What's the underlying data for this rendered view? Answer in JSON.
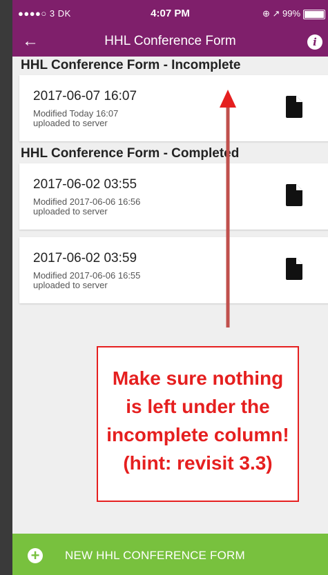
{
  "status": {
    "carrier": "●●●●○ 3 DK",
    "time": "4:07 PM",
    "right": "⊕ ↗ 99%"
  },
  "appbar": {
    "title": "HHL Conference Form"
  },
  "sections": {
    "incomplete": {
      "header": "HHL Conference Form - Incomplete",
      "items": [
        {
          "date": "2017-06-07 16:07",
          "modified": "Modified Today 16:07",
          "status": "uploaded to server"
        }
      ]
    },
    "completed": {
      "header": "HHL Conference Form - Completed",
      "items": [
        {
          "date": "2017-06-02 03:55",
          "modified": "Modified 2017-06-06 16:56",
          "status": "uploaded to server"
        },
        {
          "date": "2017-06-02 03:59",
          "modified": "Modified 2017-06-06 16:55",
          "status": "uploaded to server"
        }
      ]
    }
  },
  "annotation": {
    "lines": [
      "Make sure nothing",
      "is left under the",
      "incomplete column!",
      "(hint: revisit 3.3)"
    ],
    "color": "#e51f1f",
    "arrow_color": "#c0504d"
  },
  "footer": {
    "label": "NEW HHL CONFERENCE FORM"
  },
  "colors": {
    "appbar": "#7f1f6b",
    "footer": "#78c13e"
  }
}
